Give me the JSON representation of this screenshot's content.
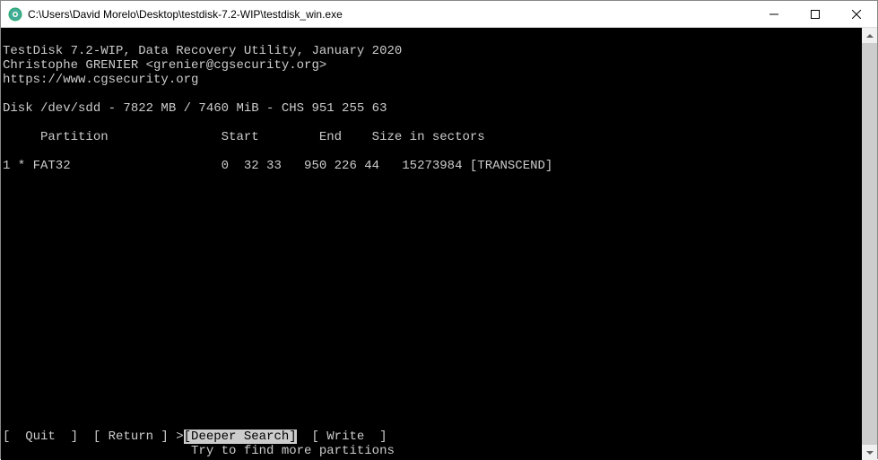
{
  "window": {
    "title": "C:\\Users\\David Morelo\\Desktop\\testdisk-7.2-WIP\\testdisk_win.exe"
  },
  "header": {
    "line1": "TestDisk 7.2-WIP, Data Recovery Utility, January 2020",
    "line2": "Christophe GRENIER <grenier@cgsecurity.org>",
    "line3": "https://www.cgsecurity.org"
  },
  "disk": {
    "line": "Disk /dev/sdd - 7822 MB / 7460 MiB - CHS 951 255 63"
  },
  "columns": "     Partition               Start        End    Size in sectors",
  "partition_row": "1 * FAT32                    0  32 33   950 226 44   15273984 [TRANSCEND]",
  "menu": {
    "prefix": "[  Quit  ]  [ Return ] ",
    "cursor": ">",
    "selected": "[Deeper Search]",
    "suffix": "  [ Write  ]"
  },
  "hint": "                         Try to find more partitions"
}
